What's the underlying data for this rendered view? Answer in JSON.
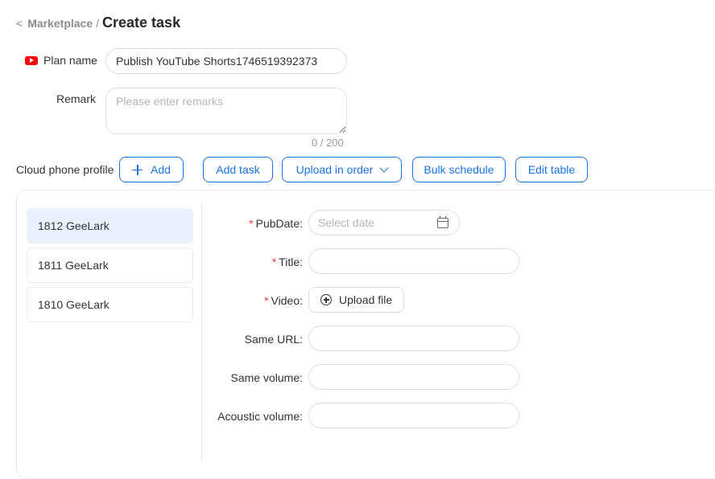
{
  "breadcrumb": {
    "back": "<",
    "parent": "Marketplace",
    "separator": "/",
    "title": "Create task"
  },
  "form": {
    "plan_name_label": "Plan name",
    "plan_name_value": "Publish YouTube Shorts1746519392373",
    "remark_label": "Remark",
    "remark_placeholder": "Please enter remarks",
    "remark_counter": "0 / 200",
    "cloud_phone_label": "Cloud phone profile"
  },
  "toolbar": {
    "add": "Add",
    "add_task": "Add task",
    "upload_in_order": "Upload in order",
    "bulk_schedule": "Bulk schedule",
    "edit_table": "Edit table"
  },
  "profiles": [
    "1812 GeeLark",
    "1811 GeeLark",
    "1810 GeeLark"
  ],
  "task_form": {
    "required_mark": "*",
    "pubdate_label": "PubDate",
    "pubdate_placeholder": "Select date",
    "title_label": "Title",
    "video_label": "Video",
    "upload_button": "Upload file",
    "same_url_label": "Same URL",
    "same_volume_label": "Same volume",
    "acoustic_volume_label": "Acoustic volume",
    "colon": ":"
  },
  "colors": {
    "accent": "#1a73e8",
    "required": "#e53935",
    "active_profile_bg": "#e8f1fd",
    "youtube_red": "#ff0000"
  }
}
